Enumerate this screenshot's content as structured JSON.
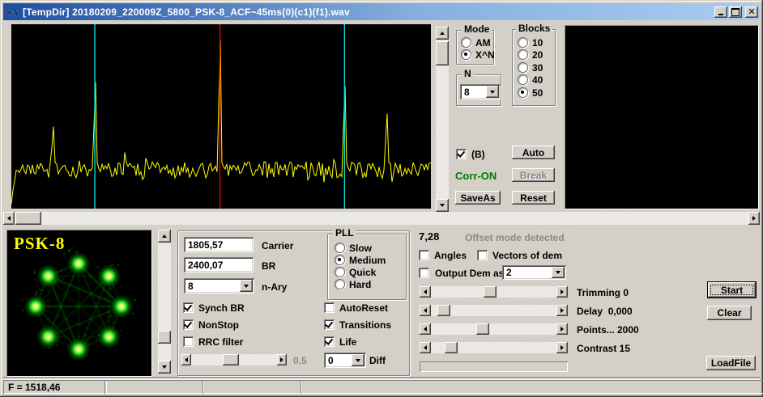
{
  "window": {
    "title": "[TempDir] 20180209_220009Z_5800_PSK-8_ACF~45ms(0)(c1)(f1).wav",
    "icon_text": "SA"
  },
  "acf_plot": {
    "type": "line",
    "bg": "#000000",
    "trace_color": "#ffff00",
    "noise_floor_frac": 0.79,
    "noise_amp_frac": 0.045,
    "seed": 1337,
    "markers": [
      {
        "name": "cursor-cyan-left",
        "color": "#00e0e0",
        "x_frac": 0.199
      },
      {
        "name": "cursor-red-center",
        "color": "#ee0000",
        "x_frac": 0.497
      },
      {
        "name": "cursor-cyan-right",
        "color": "#00e0e0",
        "x_frac": 0.794
      }
    ],
    "peaks": [
      {
        "x_frac": 0.1,
        "top_frac": 0.555
      },
      {
        "x_frac": 0.199,
        "top_frac": 0.315
      },
      {
        "x_frac": 0.497,
        "top_frac": 0.085
      },
      {
        "x_frac": 0.794,
        "top_frac": 0.335
      },
      {
        "x_frac": 0.894,
        "top_frac": 0.485
      }
    ]
  },
  "mode_group": {
    "label": "Mode",
    "options": [
      {
        "label": "AM",
        "selected": false
      },
      {
        "label": "X^N",
        "selected": true
      }
    ]
  },
  "n_group": {
    "label": "N",
    "value": "8"
  },
  "blocks_group": {
    "label": "Blocks",
    "options": [
      {
        "label": "10",
        "selected": false
      },
      {
        "label": "20",
        "selected": false
      },
      {
        "label": "30",
        "selected": false
      },
      {
        "label": "40",
        "selected": false
      },
      {
        "label": "50",
        "selected": true
      }
    ]
  },
  "correlation": {
    "b_checkbox_label": "(B)",
    "b_checked": true,
    "status": "Corr-ON",
    "auto": "Auto",
    "break": "Break",
    "break_enabled": false,
    "saveas": "SaveAs",
    "reset": "Reset"
  },
  "constellation": {
    "label": "PSK-8",
    "points": 8,
    "seed": 7,
    "color": "#00c800",
    "bg": "#000000"
  },
  "params": {
    "carrier_value": "1805,57",
    "carrier_label": "Carrier",
    "br_value": "2400,07",
    "br_label": "BR",
    "nary_value": "8",
    "nary_label": "n-Ary",
    "pll": {
      "label": "PLL",
      "options": [
        {
          "label": "Slow",
          "selected": false
        },
        {
          "label": "Medium",
          "selected": true
        },
        {
          "label": "Quick",
          "selected": false
        },
        {
          "label": "Hard",
          "selected": false
        }
      ]
    },
    "checks": {
      "synch_br": {
        "label": "Synch BR",
        "checked": true
      },
      "nonstop": {
        "label": "NonStop",
        "checked": true
      },
      "rrc": {
        "label": "RRC filter",
        "checked": false
      },
      "autoreset": {
        "label": "AutoReset",
        "checked": false
      },
      "transitions": {
        "label": "Transitions",
        "checked": true
      },
      "life": {
        "label": "Life",
        "checked": true
      }
    },
    "rrc_slider": {
      "value_label": "0,5",
      "thumb_frac": 0.45
    },
    "diff": {
      "value": "0",
      "label": "Diff"
    }
  },
  "demod": {
    "offset_value": "7,28",
    "offset_status": "Offset mode detected",
    "angles_label": "Angles",
    "vectors_label": "Vectors of dem",
    "output_dem_label": "Output Dem as",
    "output_dem_value": "2",
    "sliders": [
      {
        "label": "Trimming 0",
        "thumb_frac": 0.47
      },
      {
        "label": "Delay  0,000",
        "thumb_frac": 0.06
      },
      {
        "label": "Points... 2000",
        "thumb_frac": 0.4
      },
      {
        "label": "Contrast 15",
        "thumb_frac": 0.12
      }
    ]
  },
  "actions": {
    "start": "Start",
    "clear": "Clear",
    "loadfile": "LoadFile"
  },
  "status_bar": {
    "field1": "F = 1518,46",
    "field2": "",
    "field3": "",
    "field4": ""
  }
}
